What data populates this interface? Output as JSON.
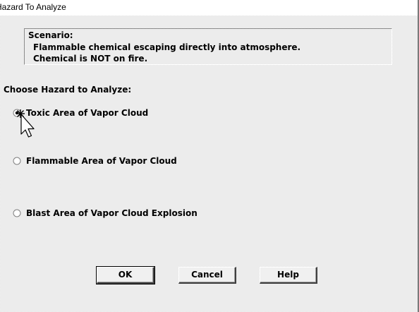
{
  "window": {
    "title": "Hazard To Analyze"
  },
  "scenario": {
    "heading": "Scenario:",
    "line1": "Flammable chemical escaping directly into atmosphere.",
    "line2": "Chemical is NOT on fire."
  },
  "hazard_group": {
    "label": "Choose Hazard to Analyze:",
    "selected": "Toxic Area of Vapor Cloud",
    "options": [
      {
        "label": "Toxic Area of Vapor Cloud",
        "checked": true
      },
      {
        "label": "Flammable Area of Vapor Cloud",
        "checked": false
      },
      {
        "label": "Blast Area of Vapor Cloud Explosion",
        "checked": false
      }
    ]
  },
  "buttons": {
    "ok": "OK",
    "cancel": "Cancel",
    "help": "Help"
  },
  "icons": {
    "cursor": "mouse-pointer-arrow-icon",
    "radio": "radio-button-icon"
  }
}
